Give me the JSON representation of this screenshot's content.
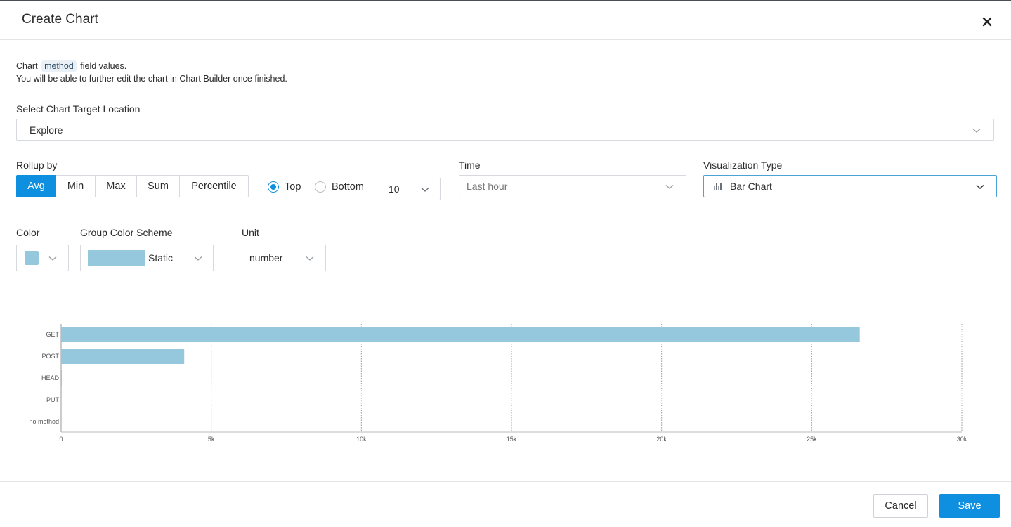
{
  "dialog": {
    "title": "Create Chart",
    "close_icon": "close-icon"
  },
  "description": {
    "line1_prefix": "Chart",
    "field_chip": "method",
    "line1_suffix": "field values.",
    "line2": "You will be able to further edit the chart in Chart Builder once finished."
  },
  "target_location": {
    "label": "Select Chart Target Location",
    "value": "Explore"
  },
  "rollup": {
    "label": "Rollup by",
    "options": [
      "Avg",
      "Min",
      "Max",
      "Sum",
      "Percentile"
    ],
    "selected": "Avg"
  },
  "order": {
    "top_label": "Top",
    "bottom_label": "Bottom",
    "selected": "Top",
    "limit_value": "10"
  },
  "time": {
    "label": "Time",
    "value": "Last hour"
  },
  "visualization": {
    "label": "Visualization Type",
    "value": "Bar Chart",
    "icon": "bar-chart-icon"
  },
  "color": {
    "label": "Color",
    "value": "#95c8dd"
  },
  "group_color_scheme": {
    "label": "Group Color Scheme",
    "value": "Static"
  },
  "unit": {
    "label": "Unit",
    "value": "number"
  },
  "chart_data": {
    "type": "bar",
    "orientation": "horizontal",
    "categories": [
      "GET",
      "POST",
      "HEAD",
      "PUT",
      "no method"
    ],
    "values": [
      26600,
      4100,
      20,
      0,
      0
    ],
    "x_ticks": [
      "0",
      "5k",
      "10k",
      "15k",
      "20k",
      "25k",
      "30k"
    ],
    "xlim": [
      0,
      30000
    ],
    "bar_color": "#95c8dd",
    "grid": "vertical-dotted"
  },
  "footer": {
    "cancel_label": "Cancel",
    "save_label": "Save"
  }
}
